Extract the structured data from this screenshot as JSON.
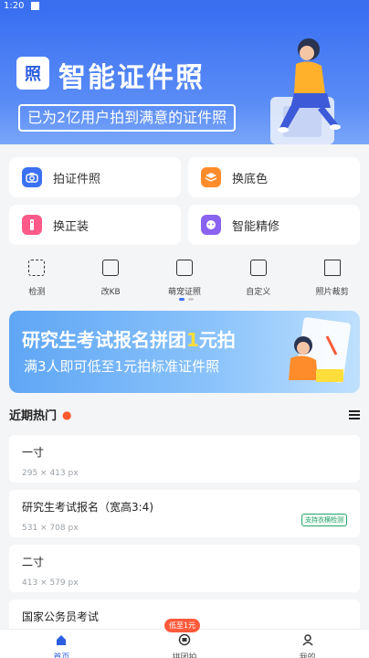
{
  "status": {
    "time": "1:20"
  },
  "hero": {
    "logo_glyph": "照",
    "title": "智能证件照",
    "slogan": "已为2亿用户拍到满意的证件照"
  },
  "big_actions": [
    {
      "label": "拍证件照",
      "icon": "camera-icon",
      "color": "#3b70f2"
    },
    {
      "label": "换底色",
      "icon": "layers-icon",
      "color": "#ff8c2b"
    },
    {
      "label": "换正装",
      "icon": "suit-icon",
      "color": "#ff5a8a"
    },
    {
      "label": "智能精修",
      "icon": "face-icon",
      "color": "#8a63f0"
    }
  ],
  "tools": [
    {
      "label": "检测",
      "icon": "scan-icon"
    },
    {
      "label": "改KB",
      "icon": "edit-file-icon"
    },
    {
      "label": "萌宠证照",
      "icon": "plus-square-icon"
    },
    {
      "label": "自定义",
      "icon": "plus-square-icon"
    },
    {
      "label": "照片裁剪",
      "icon": "crop-icon"
    }
  ],
  "banner": {
    "line1_a": "研究生考试报名拼团",
    "line1_b": "1",
    "line1_c": "元拍",
    "line2": "满3人即可低至1元拍标准证件照"
  },
  "section": {
    "title": "近期热门"
  },
  "list": [
    {
      "name": "一寸",
      "size": "295 × 413 px",
      "tag": ""
    },
    {
      "name": "研究生考试报名（宽高3:4)",
      "size": "531 × 708 px",
      "tag": "支持衣横检测"
    },
    {
      "name": "二寸",
      "size": "413 × 579 px",
      "tag": ""
    },
    {
      "name": "国家公务员考试",
      "size": "",
      "tag": ""
    }
  ],
  "bottom_nav": {
    "home": "首页",
    "group": "拼团拍",
    "mine": "我的",
    "promo": "低至1元"
  },
  "colors": {
    "primary": "#3b70f2",
    "accent": "#ff5a3b"
  }
}
